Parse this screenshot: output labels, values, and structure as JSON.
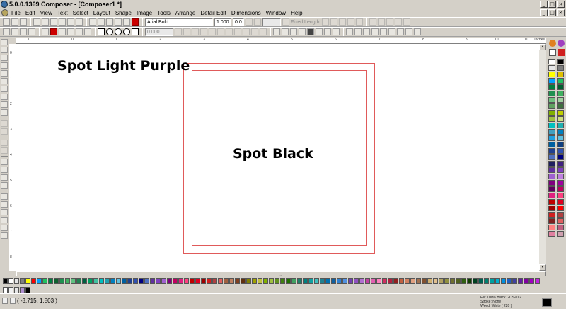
{
  "window": {
    "title": "5.0.0.1369 Composer - [Composer1 *]",
    "minimize_glyph": "_",
    "restore_glyph": "□",
    "close_glyph": "×"
  },
  "menu": {
    "items": [
      "File",
      "Edit",
      "View",
      "Text",
      "Select",
      "Layout",
      "Shape",
      "Image",
      "Tools",
      "Arrange",
      "Detail Edit",
      "Dimensions",
      "Window",
      "Help"
    ]
  },
  "toolbar": {
    "font_name": "Arial Bold",
    "font_size": "1.000",
    "spacing": "0.0",
    "fixed_length_label": "Fixed Length",
    "stroke_width": "0.000"
  },
  "ruler": {
    "units": "Inches",
    "top_ticks": [
      "1",
      "0",
      "1",
      "2",
      "3",
      "4",
      "5",
      "6",
      "7",
      "8",
      "9",
      "10",
      "11"
    ],
    "left_ticks": [
      "0",
      "1",
      "2",
      "3",
      "4",
      "5",
      "6",
      "7",
      "8"
    ]
  },
  "canvas": {
    "label_purple": "Spot Light Purple",
    "label_black": "Spot Black",
    "outline_color": "#e05a5a"
  },
  "status": {
    "coordinates": "( -3.715, 1.803 )",
    "fill": "Fill: 100% Black GCS-012",
    "stroke": "Stroke: None",
    "weed": "Weed: White ( 220 )"
  },
  "palette": {
    "right_colors": [
      "#ffffff",
      "#000000",
      "#e6e6e6",
      "#808080",
      "#ffff00",
      "#e0c000",
      "#00a0ff",
      "#20c060",
      "#008040",
      "#006030",
      "#209050",
      "#40b060",
      "#70c080",
      "#a0d0a0",
      "#60a060",
      "#407040",
      "#80b000",
      "#c0d000",
      "#a0c040",
      "#d0e080",
      "#00c0c0",
      "#20b0b0",
      "#40a0c0",
      "#0080c0",
      "#20a0e0",
      "#60c0e0",
      "#0060a0",
      "#104080",
      "#204090",
      "#3050b0",
      "#5070c0",
      "#000080",
      "#202060",
      "#402080",
      "#6030a0",
      "#8040c0",
      "#a060d0",
      "#c080e0",
      "#800080",
      "#a000a0",
      "#600060",
      "#c00060",
      "#e02080",
      "#ff4080",
      "#c00000",
      "#e00020",
      "#a00000",
      "#ff0000",
      "#d02020",
      "#b04040",
      "#802020",
      "#e06060",
      "#ff8080",
      "#c06080",
      "#e080a0",
      "#d0a0b0",
      "#a06040",
      "#c08060",
      "#804020",
      "#603010",
      "#b08050"
    ],
    "bottom_colors": [
      "#000000",
      "#ffffff",
      "#e6e6e6",
      "#808080",
      "#ffff00",
      "#ff0000",
      "#00a0ff",
      "#20c060",
      "#008040",
      "#106030",
      "#209050",
      "#40b060",
      "#60c080",
      "#208050",
      "#006040",
      "#00a060",
      "#40c0a0",
      "#00c0c0",
      "#20a0b0",
      "#0080c0",
      "#60c0e0",
      "#0060a0",
      "#204090",
      "#3050b0",
      "#000080",
      "#5070c0",
      "#6030a0",
      "#8040c0",
      "#a060d0",
      "#800080",
      "#c00060",
      "#e02080",
      "#ff4080",
      "#c00000",
      "#e00020",
      "#a00000",
      "#d02020",
      "#b04040",
      "#e06060",
      "#a06040",
      "#c08060",
      "#804020",
      "#603010",
      "#808000",
      "#a0a000",
      "#c0c040",
      "#80b000",
      "#a0c040",
      "#609020",
      "#408010",
      "#207000",
      "#40a060",
      "#20806a",
      "#008080",
      "#10a0a0",
      "#40c0c0",
      "#208090",
      "#0070b0",
      "#1060a0",
      "#3080d0",
      "#5090e0",
      "#7040b0",
      "#9050c0",
      "#b070d0",
      "#c040a0",
      "#e060b0",
      "#ff80c0",
      "#d03060",
      "#b02040",
      "#902020",
      "#c06040",
      "#d08060",
      "#e0a080",
      "#a07050",
      "#805030",
      "#d0b070",
      "#e0c090",
      "#b0a060",
      "#909040",
      "#707030",
      "#506020",
      "#306010",
      "#104000",
      "#004020",
      "#006050",
      "#008070",
      "#00a0a0",
      "#00b0d0",
      "#0090e0",
      "#2060c0",
      "#4040a0",
      "#6020a0",
      "#8000a0",
      "#a000c0",
      "#c020e0"
    ],
    "recent_colors": [
      "#ffffff",
      "#f0f0f0",
      "#e6e6e6",
      "#b090d0",
      "#000000"
    ],
    "top_icon_1": "#e08020",
    "top_icon_2": "#a040c0"
  }
}
